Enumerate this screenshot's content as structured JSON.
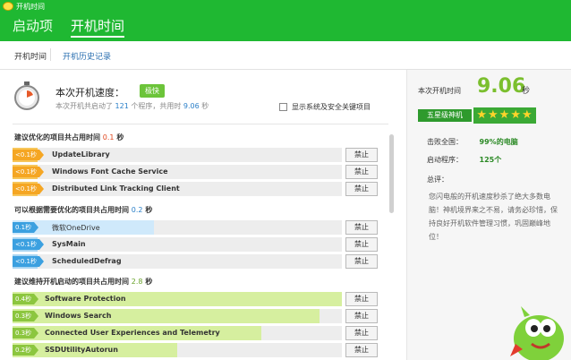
{
  "window": {
    "title": "开机时间"
  },
  "tabs": [
    {
      "label": "启动项"
    },
    {
      "label": "开机时间"
    }
  ],
  "subnav": {
    "current": "开机时间",
    "history": "开机历史记录"
  },
  "speed": {
    "label": "本次开机速度：",
    "badge": "极快",
    "detail_prefix": "本次开机共启动了",
    "count": "121",
    "detail_mid": "个程序，共用时",
    "time": "9.06",
    "detail_suffix": "秒"
  },
  "show_system": "显示系统及安全关键项目",
  "sections": [
    {
      "title": "建议优化的项目共占用时间",
      "time": "0.1",
      "unit": "秒",
      "rows": [
        {
          "badge": "<0.1秒",
          "name": "UpdateLibrary",
          "button": "禁止"
        },
        {
          "badge": "<0.1秒",
          "name": "Windows Font Cache Service",
          "button": "禁止"
        },
        {
          "badge": "<0.1秒",
          "name": "Distributed Link Tracking Client",
          "button": "禁止"
        }
      ]
    },
    {
      "title": "可以根据需要优化的项目共占用时间",
      "time": "0.2",
      "unit": "秒",
      "rows": [
        {
          "badge": "0.1秒",
          "name": "微软OneDrive",
          "button": "禁止"
        },
        {
          "badge": "<0.1秒",
          "name": "SysMain",
          "button": "禁止"
        },
        {
          "badge": "<0.1秒",
          "name": "ScheduledDefrag",
          "button": "禁止"
        }
      ]
    },
    {
      "title": "建议维持开机启动的项目共占用时间",
      "time": "2.8",
      "unit": "秒",
      "rows": [
        {
          "badge": "0.4秒",
          "name": "Software Protection",
          "button": "禁止",
          "fill": 1.0
        },
        {
          "badge": "0.3秒",
          "name": "Windows Search",
          "button": "禁止",
          "fill": 0.93
        },
        {
          "badge": "0.3秒",
          "name": "Connected User Experiences and Telemetry",
          "button": "禁止",
          "fill": 0.75
        },
        {
          "badge": "0.2秒",
          "name": "SSDUtilityAutorun",
          "button": "禁止",
          "fill": 0.5
        }
      ]
    }
  ],
  "right": {
    "time_label": "本次开机时间",
    "time": "9.06",
    "unit": "秒",
    "level": "五星级神机",
    "stars": "★★★★★",
    "beat_label": "击败全国：",
    "beat_value": "99%的电脑",
    "programs_label": "启动程序：",
    "programs_value": "125个",
    "summary_title": "总评：",
    "summary": "您闪电般的开机速度秒杀了绝大多数电脑！神机境界来之不易，请务必珍惜，保持良好开机软件管理习惯，巩固巅峰地位！"
  },
  "colors": {
    "brand": "#1fb832",
    "orange": "#f5a623",
    "blue": "#3ba0e0",
    "green": "#8cc63f"
  }
}
